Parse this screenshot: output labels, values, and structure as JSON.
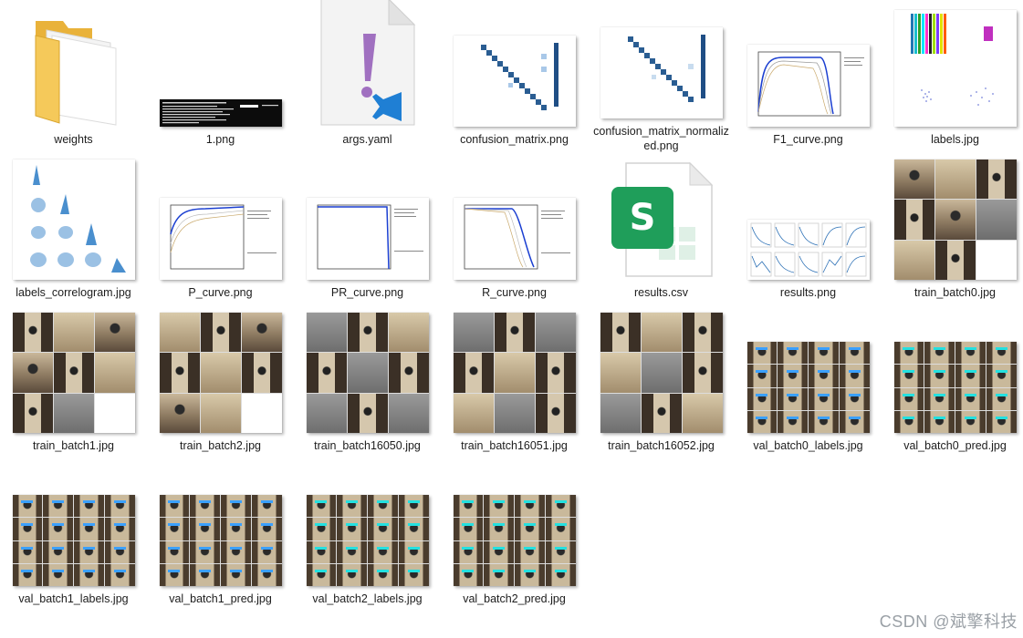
{
  "files": [
    {
      "name": "weights",
      "kind": "folder"
    },
    {
      "name": "1.png",
      "kind": "terminal"
    },
    {
      "name": "args.yaml",
      "kind": "yaml"
    },
    {
      "name": "confusion_matrix.png",
      "kind": "matrix"
    },
    {
      "name": "confusion_matrix_normalized.png",
      "kind": "matrix"
    },
    {
      "name": "F1_curve.png",
      "kind": "curve"
    },
    {
      "name": "labels.jpg",
      "kind": "labels"
    },
    {
      "name": "labels_correlogram.jpg",
      "kind": "correlogram"
    },
    {
      "name": "P_curve.png",
      "kind": "curve"
    },
    {
      "name": "PR_curve.png",
      "kind": "curve"
    },
    {
      "name": "R_curve.png",
      "kind": "curve"
    },
    {
      "name": "results.csv",
      "kind": "csv"
    },
    {
      "name": "results.png",
      "kind": "results"
    },
    {
      "name": "train_batch0.jpg",
      "kind": "mosaic"
    },
    {
      "name": "train_batch1.jpg",
      "kind": "mosaic"
    },
    {
      "name": "train_batch2.jpg",
      "kind": "mosaic"
    },
    {
      "name": "train_batch16050.jpg",
      "kind": "mosaic"
    },
    {
      "name": "train_batch16051.jpg",
      "kind": "mosaic"
    },
    {
      "name": "train_batch16052.jpg",
      "kind": "mosaic"
    },
    {
      "name": "val_batch0_labels.jpg",
      "kind": "val"
    },
    {
      "name": "val_batch0_pred.jpg",
      "kind": "val"
    },
    {
      "name": "val_batch1_labels.jpg",
      "kind": "val"
    },
    {
      "name": "val_batch1_pred.jpg",
      "kind": "val"
    },
    {
      "name": "val_batch2_labels.jpg",
      "kind": "val"
    },
    {
      "name": "val_batch2_pred.jpg",
      "kind": "val"
    }
  ],
  "watermark": "CSDN @斌擎科技",
  "colors": {
    "folder": "#f2c44e",
    "vscode_blue": "#1f7fd4",
    "yaml_purple": "#a070c0",
    "csv_green": "#1f9e5a",
    "matrix_blue": "#2a5d92",
    "val_box_blue": "#3aa0ff",
    "val_box_cyan": "#23e0e0"
  }
}
